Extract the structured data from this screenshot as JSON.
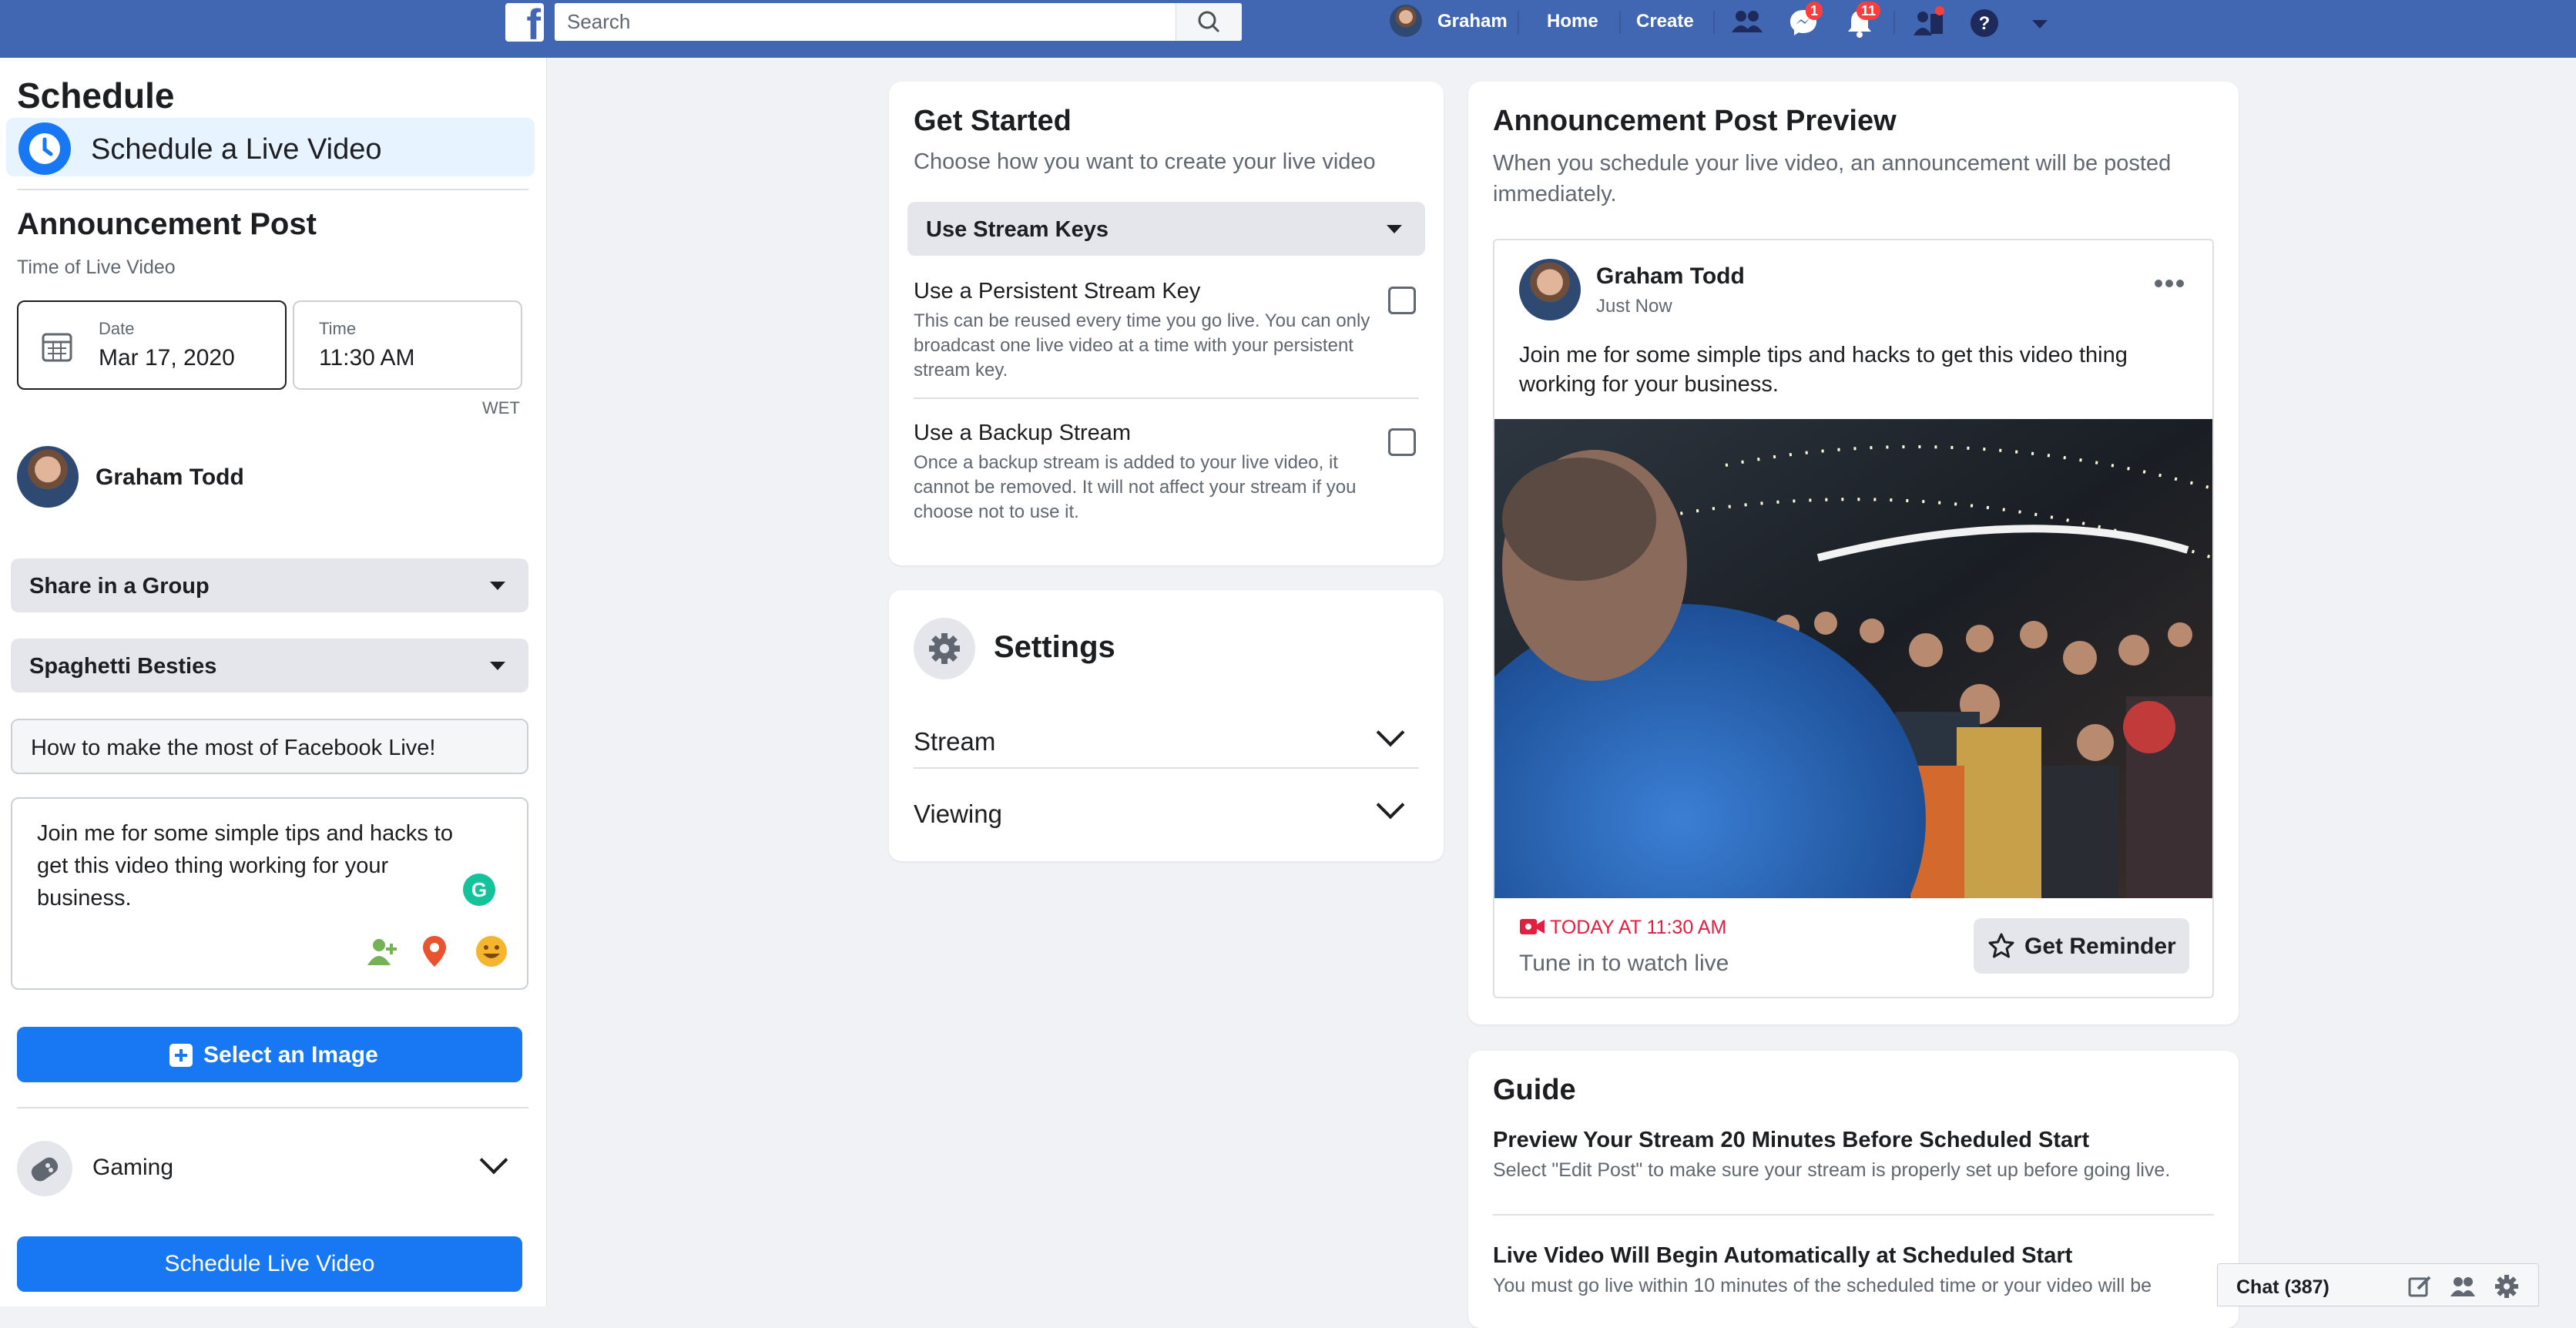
{
  "topbar": {
    "search_placeholder": "Search",
    "user_name": "Graham",
    "home": "Home",
    "create": "Create",
    "messages_count": "1",
    "notifications_count": "11"
  },
  "sidebar": {
    "title": "Schedule",
    "schedule_item": "Schedule a Live Video",
    "announcement_title": "Announcement Post",
    "time_label": "Time of Live Video",
    "date_label": "Date",
    "date_value": "Mar 17, 2020",
    "time_field_label": "Time",
    "time_value": "11:30 AM",
    "timezone": "WET",
    "user_name": "Graham Todd",
    "share_select": "Share in a Group",
    "group_select": "Spaghetti Besties",
    "title_value": "How to make the most of Facebook Live!",
    "description": "Join me for some simple tips and hacks to get this video thing working for your business.",
    "select_image": "Select an Image",
    "category": "Gaming",
    "schedule_button": "Schedule Live Video"
  },
  "get_started": {
    "title": "Get Started",
    "subtitle": "Choose how you want to create your live video",
    "stream_select": "Use Stream Keys",
    "options": [
      {
        "title": "Use a Persistent Stream Key",
        "desc": "This can be reused every time you go live. You can only broadcast one live video at a time with your persistent stream key."
      },
      {
        "title": "Use a Backup Stream",
        "desc": "Once a backup stream is added to your live video, it cannot be removed. It will not affect your stream if you choose not to use it."
      }
    ]
  },
  "settings": {
    "title": "Settings",
    "items": [
      "Stream",
      "Viewing"
    ]
  },
  "preview": {
    "title": "Announcement Post Preview",
    "subtitle": "When you schedule your live video, an announcement will be posted immediately.",
    "author": "Graham Todd",
    "time": "Just Now",
    "text": "Join me for some simple tips and hacks to get this video thing working for your business.",
    "live_time": "TODAY AT 11:30 AM",
    "tune_in": "Tune in to watch live",
    "reminder": "Get Reminder"
  },
  "guide": {
    "title": "Guide",
    "items": [
      {
        "title": "Preview Your Stream 20 Minutes Before Scheduled Start",
        "desc": "Select \"Edit Post\" to make sure your stream is properly set up before going live."
      },
      {
        "title": "Live Video Will Begin Automatically at Scheduled Start",
        "desc": "You must go live within 10 minutes of the scheduled time or your video will be"
      }
    ]
  },
  "chat": {
    "label": "Chat (387)"
  },
  "colors": {
    "brand": "#4267b2",
    "primary": "#1877f2",
    "live_red": "#e41e3f"
  }
}
